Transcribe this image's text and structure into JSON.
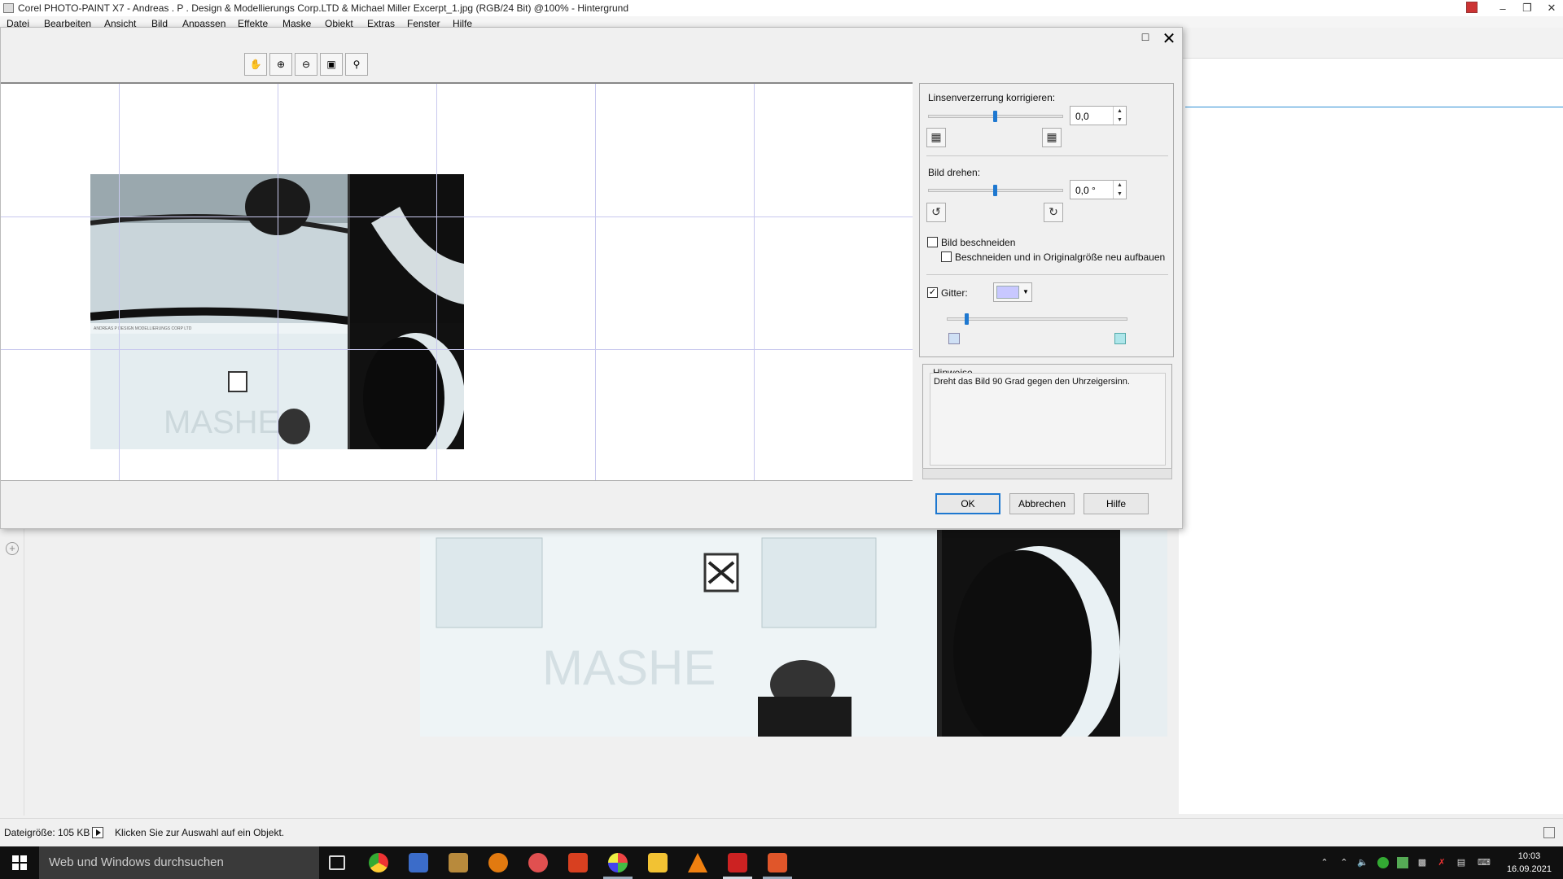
{
  "app": {
    "title": "Corel PHOTO-PAINT X7 - Andreas . P . Design & Modellierungs Corp.LTD & Michael Miller Excerpt_1.jpg (RGB/24 Bit) @100% - Hintergrund",
    "menu": [
      "Datei",
      "Bearbeiten",
      "Ansicht",
      "Bild",
      "Anpassen",
      "Effekte",
      "Maske",
      "Objekt",
      "Extras",
      "Fenster",
      "Hilfe"
    ]
  },
  "dialog": {
    "toolbar_icons": [
      "hand-icon",
      "zoom-in-icon",
      "zoom-out-icon",
      "fit-window-icon",
      "zoom-100-icon"
    ],
    "lens": {
      "label": "Linsenverzerrung korrigieren:",
      "value": "0,0",
      "slider_fraction": 0.5
    },
    "rotate": {
      "label": "Bild drehen:",
      "value": "0,0 °",
      "slider_fraction": 0.5
    },
    "crop": {
      "label": "Bild beschneiden",
      "checked": false
    },
    "crop_resize": {
      "label": "Beschneiden und in Originalgröße neu aufbauen",
      "checked": false
    },
    "grid": {
      "label": "Gitter:",
      "checked": true,
      "color": "#c8c8ff",
      "slider_fraction": 0.1
    },
    "hints": {
      "title": "Hinweise",
      "text": "Dreht das Bild 90 Grad gegen den Uhrzeigersinn."
    },
    "buttons": {
      "ok": "OK",
      "cancel": "Abbrechen",
      "help": "Hilfe"
    }
  },
  "statusbar": {
    "filesize": "Dateigröße: 105 KB",
    "hint": "Klicken Sie zur Auswahl auf ein Objekt."
  },
  "taskbar": {
    "search_placeholder": "Web und Windows durchsuchen",
    "time": "10:03",
    "date": "16.09.2021"
  },
  "colors": {
    "accent": "#1e78d0",
    "grid": "#c8c8ee",
    "taskbar": "#101010"
  }
}
